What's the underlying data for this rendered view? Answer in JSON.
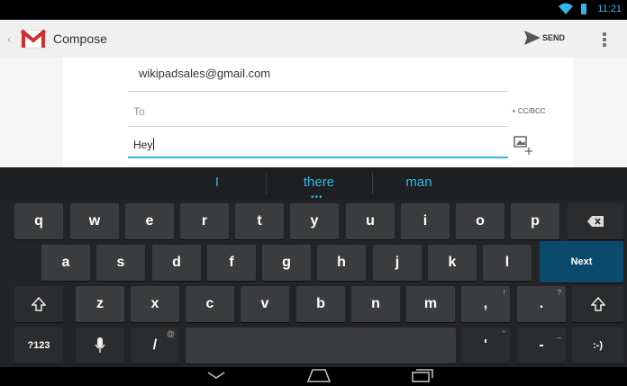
{
  "status_bar": {
    "time": "11:21",
    "wifi_icon": "wifi-icon",
    "battery_icon": "battery-icon"
  },
  "action_bar": {
    "title": "Compose",
    "send_label": "SEND",
    "logo_icon": "gmail-icon"
  },
  "compose": {
    "from": "wikipadsales@gmail.com",
    "to_placeholder": "To",
    "cc_bcc_label": "+ CC/BCC",
    "subject_value": "Hey"
  },
  "suggestions": {
    "left": "I",
    "center": "there",
    "right": "man",
    "more": "•••"
  },
  "keyboard": {
    "row1": [
      "q",
      "w",
      "e",
      "r",
      "t",
      "y",
      "u",
      "i",
      "o",
      "p"
    ],
    "row2": [
      "a",
      "s",
      "d",
      "f",
      "g",
      "h",
      "j",
      "k",
      "l"
    ],
    "row3": [
      "z",
      "x",
      "c",
      "v",
      "b",
      "n",
      "m",
      ",",
      "."
    ],
    "row3_hints": [
      "",
      "",
      "",
      "",
      "",
      "",
      "",
      "!",
      "?"
    ],
    "next_label": "Next",
    "symbols_label": "?123",
    "slash_label": "/",
    "slash_hint": "@",
    "apostrophe_label": "'",
    "apostrophe_hint": "\"",
    "dash_label": "-",
    "dash_hint": "_",
    "smiley_label": ":-)"
  },
  "colors": {
    "accent": "#33b5e5",
    "next_key": "#0b4a6f",
    "key": "#3b3c3e"
  }
}
